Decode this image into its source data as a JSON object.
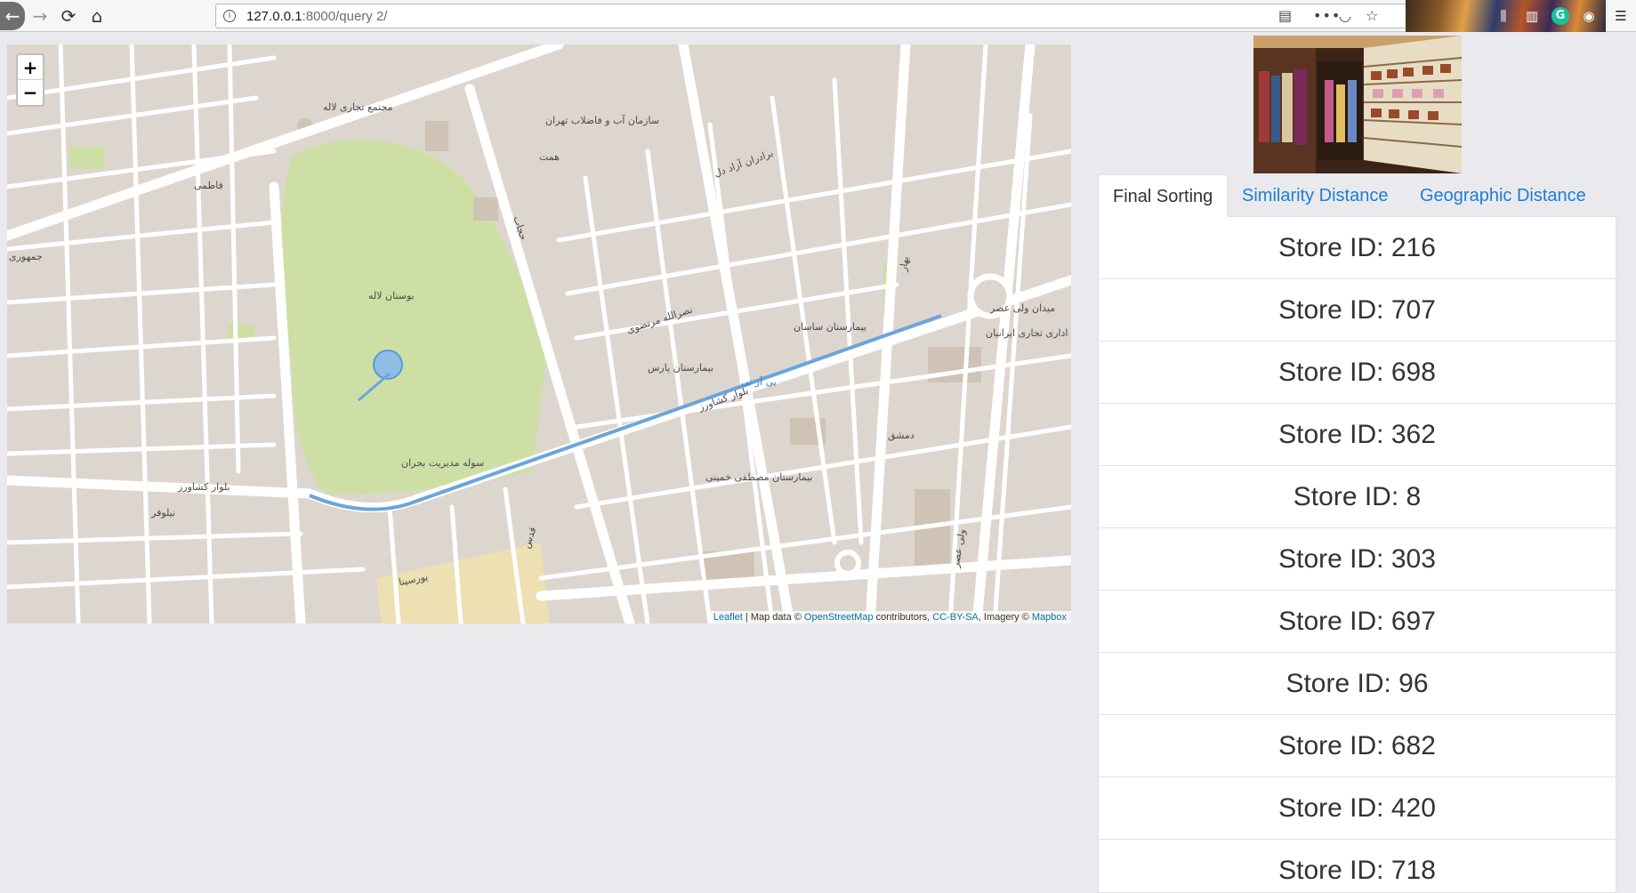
{
  "browser": {
    "url_host": "127.0.0.1",
    "url_path": ":8000/query 2/"
  },
  "map": {
    "zoom_in_label": "+",
    "zoom_out_label": "−",
    "attribution": {
      "leaflet": "Leaflet",
      "sep": " | Map data © ",
      "osm": "OpenStreetMap",
      "contrib": " contributors, ",
      "license": "CC-BY-SA",
      "imagery": ", Imagery © ",
      "mapbox": "Mapbox"
    },
    "labels": {
      "park": "بوستان لاله",
      "water_org": "سازمان آب و فاضلاب تهران",
      "commercial": "مجتمع تجاری لاله",
      "keshavarz": "بلوار کشاورز",
      "vali_asr_square": "میدان ولی عصر",
      "hospital_sasan": "بیمارستان ساسان",
      "hospital_pars": "بیمارستان پارس",
      "hospital_mostafa": "بیمارستان مصطفی خمینی",
      "brt": "بی آر تی",
      "fatemi": "فاطمی",
      "hejab": "حجاب",
      "nasrollah": "نصرالله مرتضوی",
      "azad": "برادران آزاد دل",
      "office": "ساختمان اداری تجاری ایرانیان",
      "poorsina": "پورسینا",
      "dameshgh": "دمشق",
      "vali_asr": "ولی عصر",
      "bahar": "بهار",
      "hospital_hall": "سوله مدیریت بحران",
      "hemmat": "همت",
      "nilufar": "نیلوفر",
      "jomhuri": "جمهوری",
      "ghods": "قدس"
    }
  },
  "tabs": [
    {
      "label": "Final Sorting",
      "active": true
    },
    {
      "label": "Similarity Distance",
      "active": false
    },
    {
      "label": "Geographic Distance",
      "active": false
    }
  ],
  "stores": [
    {
      "label": "Store ID: 216"
    },
    {
      "label": "Store ID: 707"
    },
    {
      "label": "Store ID: 698"
    },
    {
      "label": "Store ID: 362"
    },
    {
      "label": "Store ID: 8"
    },
    {
      "label": "Store ID: 303"
    },
    {
      "label": "Store ID: 697"
    },
    {
      "label": "Store ID: 96"
    },
    {
      "label": "Store ID: 682"
    },
    {
      "label": "Store ID: 420"
    },
    {
      "label": "Store ID: 718"
    }
  ]
}
